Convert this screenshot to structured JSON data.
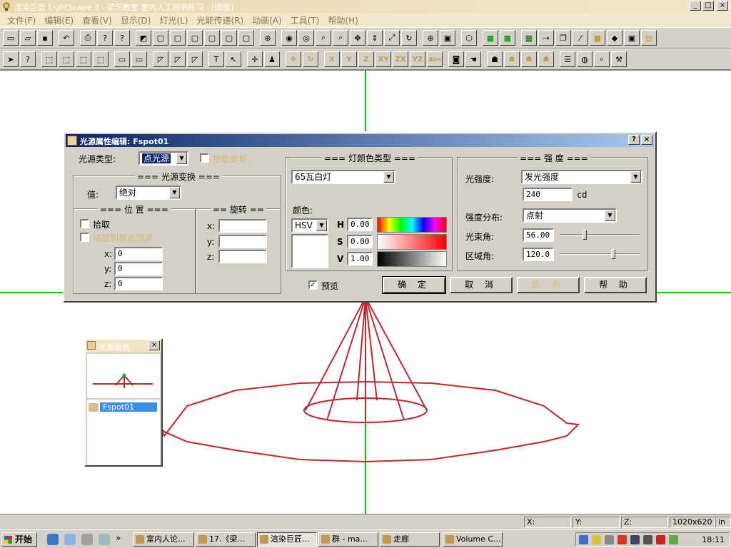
{
  "window": {
    "title": "渲染巨匠 LightScape 3 - 梁乐教室 室内人工照明练习 - [透视]",
    "controls": [
      "_",
      "□",
      "×"
    ]
  },
  "menu": [
    "文件(F)",
    "编辑(E)",
    "查看(V)",
    "显示(D)",
    "灯光(L)",
    "光能传递(R)",
    "动画(A)",
    "工具(T)",
    "帮助(H)"
  ],
  "toolbar2_axis": [
    "X",
    "Y",
    "Z",
    "XY",
    "ZX",
    "YZ",
    "Aim"
  ],
  "dialog": {
    "title": "光源属性编辑: Fspot01",
    "help_btn": "?",
    "close_btn": "×",
    "source_type_label": "光源类型:",
    "source_type_value": "点光源",
    "pick_panel_label": "拾取面板",
    "transform_group": "=== 光源变换 ===",
    "value_label": "值:",
    "value_option": "绝对",
    "position_group": "=== 位 置 ===",
    "rotation_group": "== 旋转 ==",
    "pick_label": "拾取",
    "snap_label": "捕捉到最近顶点",
    "pos": {
      "x": "0",
      "y": "0",
      "z": "0"
    },
    "rot": {
      "x_label": "x:",
      "y_label": "y:",
      "z_label": "z:"
    },
    "x_label": "x:",
    "y_label": "y:",
    "z_label": "z:",
    "color_group": "=== 灯颜色类型 ===",
    "lamp_type": "65瓦白灯",
    "color_label": "颜色:",
    "color_model": "HSV",
    "h_label": "H",
    "h_value": "0.00",
    "s_label": "S",
    "s_value": "0.00",
    "v_label": "V",
    "v_value": "1.00",
    "intensity_group": "=== 强 度 ===",
    "intensity_label": "光强度:",
    "intensity_mode": "发光强度",
    "intensity_value": "240",
    "intensity_unit": "cd",
    "distribution_label": "强度分布:",
    "distribution_value": "点射",
    "beam_label": "光束角:",
    "beam_value": "56.00",
    "beam_slider": 0.31,
    "field_label": "区域角:",
    "field_value": "120.0",
    "field_slider": 0.67,
    "preview_label": "预览",
    "ok": "确 定",
    "cancel": "取 消",
    "apply": "应 用",
    "help": "帮 助"
  },
  "mini_window": {
    "title": "光源面板",
    "close": "×",
    "item": "Fspot01"
  },
  "status": {
    "x": "X:",
    "y": "Y:",
    "z": "Z:",
    "size": "1020x620",
    "unit": "in"
  },
  "taskbar": {
    "start": "开始",
    "tasks": [
      "室内人论...",
      "17.《梁...",
      "渲染巨匠...",
      "群 - ma...",
      "走廊",
      "Volume C..."
    ],
    "active_index": 2,
    "clock": "18:11"
  }
}
